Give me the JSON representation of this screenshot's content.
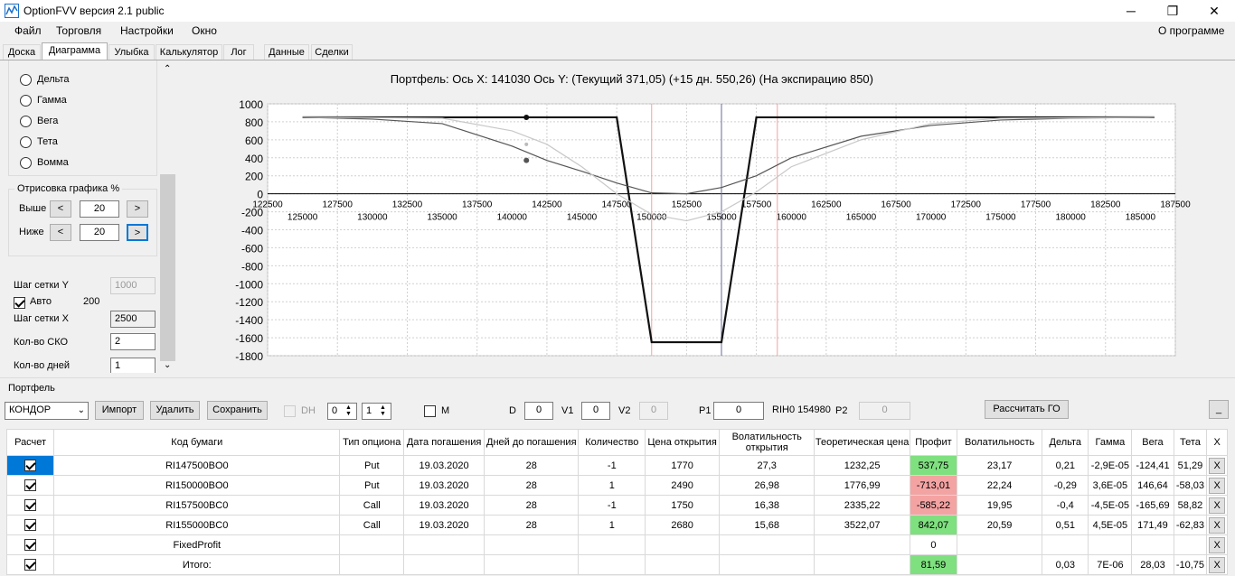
{
  "window": {
    "title": "OptionFVV версия 2.1 public",
    "minimize": "─",
    "maximize": "❐",
    "close": "✕"
  },
  "menu": {
    "items": [
      "Файл",
      "Торговля",
      "Настройки",
      "Окно"
    ],
    "about": "О программе"
  },
  "tabs": [
    "Доска",
    "Диаграмма",
    "Улыбка",
    "Калькулятор",
    "Лог",
    "Данные",
    "Сделки"
  ],
  "left": {
    "radios": [
      "Дельта",
      "Гамма",
      "Вега",
      "Тета",
      "Вомма"
    ],
    "render_group": "Отрисовка графика %",
    "above_label": "Выше",
    "above_value": "20",
    "below_label": "Ниже",
    "below_value": "20",
    "btn_left": "<",
    "btn_right": ">",
    "grid_y_label": "Шаг сетки Y",
    "grid_y_value": "1000",
    "auto_label": "Авто",
    "auto_value": "200",
    "grid_x_label": "Шаг сетки X",
    "grid_x_value": "2500",
    "sko_label": "Кол-во СКО",
    "sko_value": "2",
    "days_label": "Кол-во дней",
    "days_value": "1"
  },
  "chart": {
    "title": "Портфель: Ось X: 141030 Ось Y:  (Текущий 371,05)  (+15 дн. 550,26)  (На экспирацию 850)"
  },
  "chart_data": {
    "type": "line",
    "title": "Портфель: Ось X: 141030 Ось Y:  (Текущий 371,05)  (+15 дн. 550,26)  (На экспирацию 850)",
    "xlim": [
      122500,
      187500
    ],
    "ylim": [
      -1800,
      1000
    ],
    "x_ticks_top": [
      122500,
      127500,
      132500,
      137500,
      142500,
      147500,
      152500,
      157500,
      162500,
      167500,
      172500,
      177500,
      182500,
      187500
    ],
    "x_ticks_bottom": [
      125000,
      130000,
      135000,
      140000,
      145000,
      150000,
      155000,
      160000,
      165000,
      170000,
      175000,
      180000,
      185000
    ],
    "y_ticks": [
      1000,
      800,
      600,
      400,
      200,
      0,
      -200,
      -400,
      -600,
      -800,
      -1000,
      -1200,
      -1400,
      -1600,
      -1800
    ],
    "vlines": [
      {
        "x": 150000,
        "color": "#f4a0a0"
      },
      {
        "x": 155000,
        "color": "#6a6a9a"
      },
      {
        "x": 159000,
        "color": "#f4a0a0"
      }
    ],
    "series": [
      {
        "style": "expiry",
        "color": "#111111",
        "points": [
          [
            125000,
            850
          ],
          [
            147500,
            850
          ],
          [
            150000,
            -1650
          ],
          [
            155000,
            -1650
          ],
          [
            157500,
            850
          ],
          [
            186000,
            850
          ]
        ]
      },
      {
        "style": "current",
        "color": "#555555",
        "points": [
          [
            125000,
            850
          ],
          [
            130000,
            830
          ],
          [
            135000,
            780
          ],
          [
            140000,
            530
          ],
          [
            142500,
            371
          ],
          [
            145000,
            250
          ],
          [
            147500,
            120
          ],
          [
            150000,
            10
          ],
          [
            152500,
            0
          ],
          [
            155000,
            70
          ],
          [
            157500,
            200
          ],
          [
            160000,
            400
          ],
          [
            165000,
            640
          ],
          [
            170000,
            760
          ],
          [
            175000,
            820
          ],
          [
            180000,
            840
          ],
          [
            186000,
            850
          ]
        ]
      },
      {
        "style": "plus15",
        "color": "#c8c8c8",
        "points": [
          [
            125000,
            850
          ],
          [
            135000,
            840
          ],
          [
            140000,
            700
          ],
          [
            142500,
            550
          ],
          [
            145000,
            300
          ],
          [
            147500,
            0
          ],
          [
            150000,
            -230
          ],
          [
            152500,
            -300
          ],
          [
            155000,
            -200
          ],
          [
            157500,
            20
          ],
          [
            160000,
            300
          ],
          [
            165000,
            600
          ],
          [
            170000,
            780
          ],
          [
            175000,
            840
          ],
          [
            186000,
            850
          ]
        ]
      }
    ],
    "markers": [
      [
        141030,
        850
      ],
      [
        141030,
        371.05
      ],
      [
        141030,
        550.26
      ]
    ]
  },
  "portfolio": {
    "group_label": "Портфель",
    "select_value": "КОНДОР",
    "import": "Импорт",
    "delete": "Удалить",
    "save": "Сохранить",
    "dh_label": "DH",
    "spin1": "0",
    "spin2": "1",
    "m_label": "M",
    "d_label": "D",
    "d_value": "0",
    "v1_label": "V1",
    "v1_value": "0",
    "v2_label": "V2",
    "v2_value": "0",
    "p1_label": "P1",
    "p1_value": "0",
    "rih_label": "RIH0 154980",
    "p2_label": "P2",
    "p2_value": "0",
    "calc_go": "Рассчитать ГО",
    "minimize": "_"
  },
  "table": {
    "headers": [
      "Расчет",
      "Код бумаги",
      "Тип опциона",
      "Дата погашения",
      "Дней до погашения",
      "Количество",
      "Цена открытия",
      "Волатильность открытия",
      "Теоретическая цена",
      "Профит",
      "Волатильность",
      "Дельта",
      "Гамма",
      "Вега",
      "Тета",
      "X"
    ],
    "rows": [
      {
        "code": "RI147500BO0",
        "type": "Put",
        "date": "19.03.2020",
        "days": "28",
        "qty": "-1",
        "price": "1770",
        "vol_open": "27,3",
        "theo": "1232,25",
        "profit": "537,75",
        "profit_sign": "pos",
        "vol": "23,17",
        "delta": "0,21",
        "gamma": "-2,9E-05",
        "vega": "-124,41",
        "theta": "51,29",
        "x": "X"
      },
      {
        "code": "RI150000BO0",
        "type": "Put",
        "date": "19.03.2020",
        "days": "28",
        "qty": "1",
        "price": "2490",
        "vol_open": "26,98",
        "theo": "1776,99",
        "profit": "-713,01",
        "profit_sign": "neg",
        "vol": "22,24",
        "delta": "-0,29",
        "gamma": "3,6E-05",
        "vega": "146,64",
        "theta": "-58,03",
        "x": "X"
      },
      {
        "code": "RI157500BC0",
        "type": "Call",
        "date": "19.03.2020",
        "days": "28",
        "qty": "-1",
        "price": "1750",
        "vol_open": "16,38",
        "theo": "2335,22",
        "profit": "-585,22",
        "profit_sign": "neg",
        "vol": "19,95",
        "delta": "-0,4",
        "gamma": "-4,5E-05",
        "vega": "-165,69",
        "theta": "58,82",
        "x": "X"
      },
      {
        "code": "RI155000BC0",
        "type": "Call",
        "date": "19.03.2020",
        "days": "28",
        "qty": "1",
        "price": "2680",
        "vol_open": "15,68",
        "theo": "3522,07",
        "profit": "842,07",
        "profit_sign": "pos",
        "vol": "20,59",
        "delta": "0,51",
        "gamma": "4,5E-05",
        "vega": "171,49",
        "theta": "-62,83",
        "x": "X"
      },
      {
        "code": "FixedProfit",
        "type": "",
        "date": "",
        "days": "",
        "qty": "",
        "price": "",
        "vol_open": "",
        "theo": "",
        "profit": "0",
        "profit_sign": "",
        "vol": "",
        "delta": "",
        "gamma": "",
        "vega": "",
        "theta": "",
        "x": "X"
      },
      {
        "code": "Итого:",
        "type": "",
        "date": "",
        "days": "",
        "qty": "",
        "price": "",
        "vol_open": "",
        "theo": "",
        "profit": "81,59",
        "profit_sign": "pos",
        "vol": "",
        "delta": "0,03",
        "gamma": "7E-06",
        "vega": "28,03",
        "theta": "-10,75",
        "x": "X"
      }
    ]
  }
}
